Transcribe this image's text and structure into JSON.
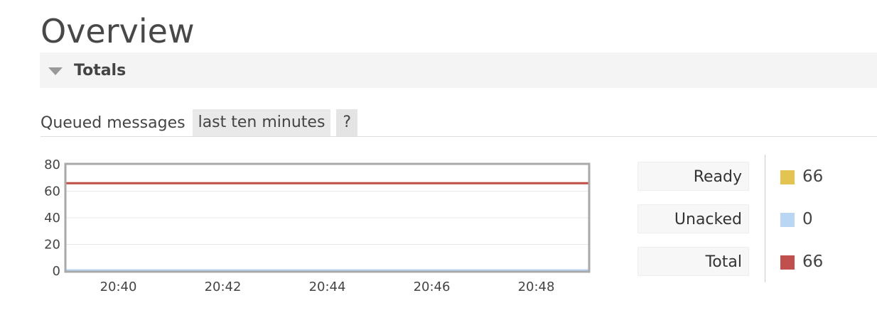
{
  "page": {
    "title": "Overview"
  },
  "section": {
    "title": "Totals"
  },
  "queued": {
    "label": "Queued messages",
    "range": "last ten minutes",
    "help": "?"
  },
  "chart_data": {
    "type": "line",
    "x": [
      "20:39",
      "20:40",
      "20:41",
      "20:42",
      "20:43",
      "20:44",
      "20:45",
      "20:46",
      "20:47",
      "20:48",
      "20:49"
    ],
    "x_ticks": [
      "20:40",
      "20:42",
      "20:44",
      "20:46",
      "20:48"
    ],
    "y_ticks": [
      "80",
      "60",
      "40",
      "20",
      "0"
    ],
    "ylim": [
      0,
      80
    ],
    "grid": true,
    "series": [
      {
        "name": "Ready",
        "color": "#e4c451",
        "values": [
          66,
          66,
          66,
          66,
          66,
          66,
          66,
          66,
          66,
          66,
          66
        ]
      },
      {
        "name": "Unacked",
        "color": "#b9d6f3",
        "values": [
          0,
          0,
          0,
          0,
          0,
          0,
          0,
          0,
          0,
          0,
          0
        ]
      },
      {
        "name": "Total",
        "color": "#c0504d",
        "values": [
          66,
          66,
          66,
          66,
          66,
          66,
          66,
          66,
          66,
          66,
          66
        ]
      }
    ]
  },
  "legend": [
    {
      "label": "Ready",
      "value": "66",
      "color": "#e4c451"
    },
    {
      "label": "Unacked",
      "value": "0",
      "color": "#b9d6f3"
    },
    {
      "label": "Total",
      "value": "66",
      "color": "#c0504d"
    }
  ]
}
